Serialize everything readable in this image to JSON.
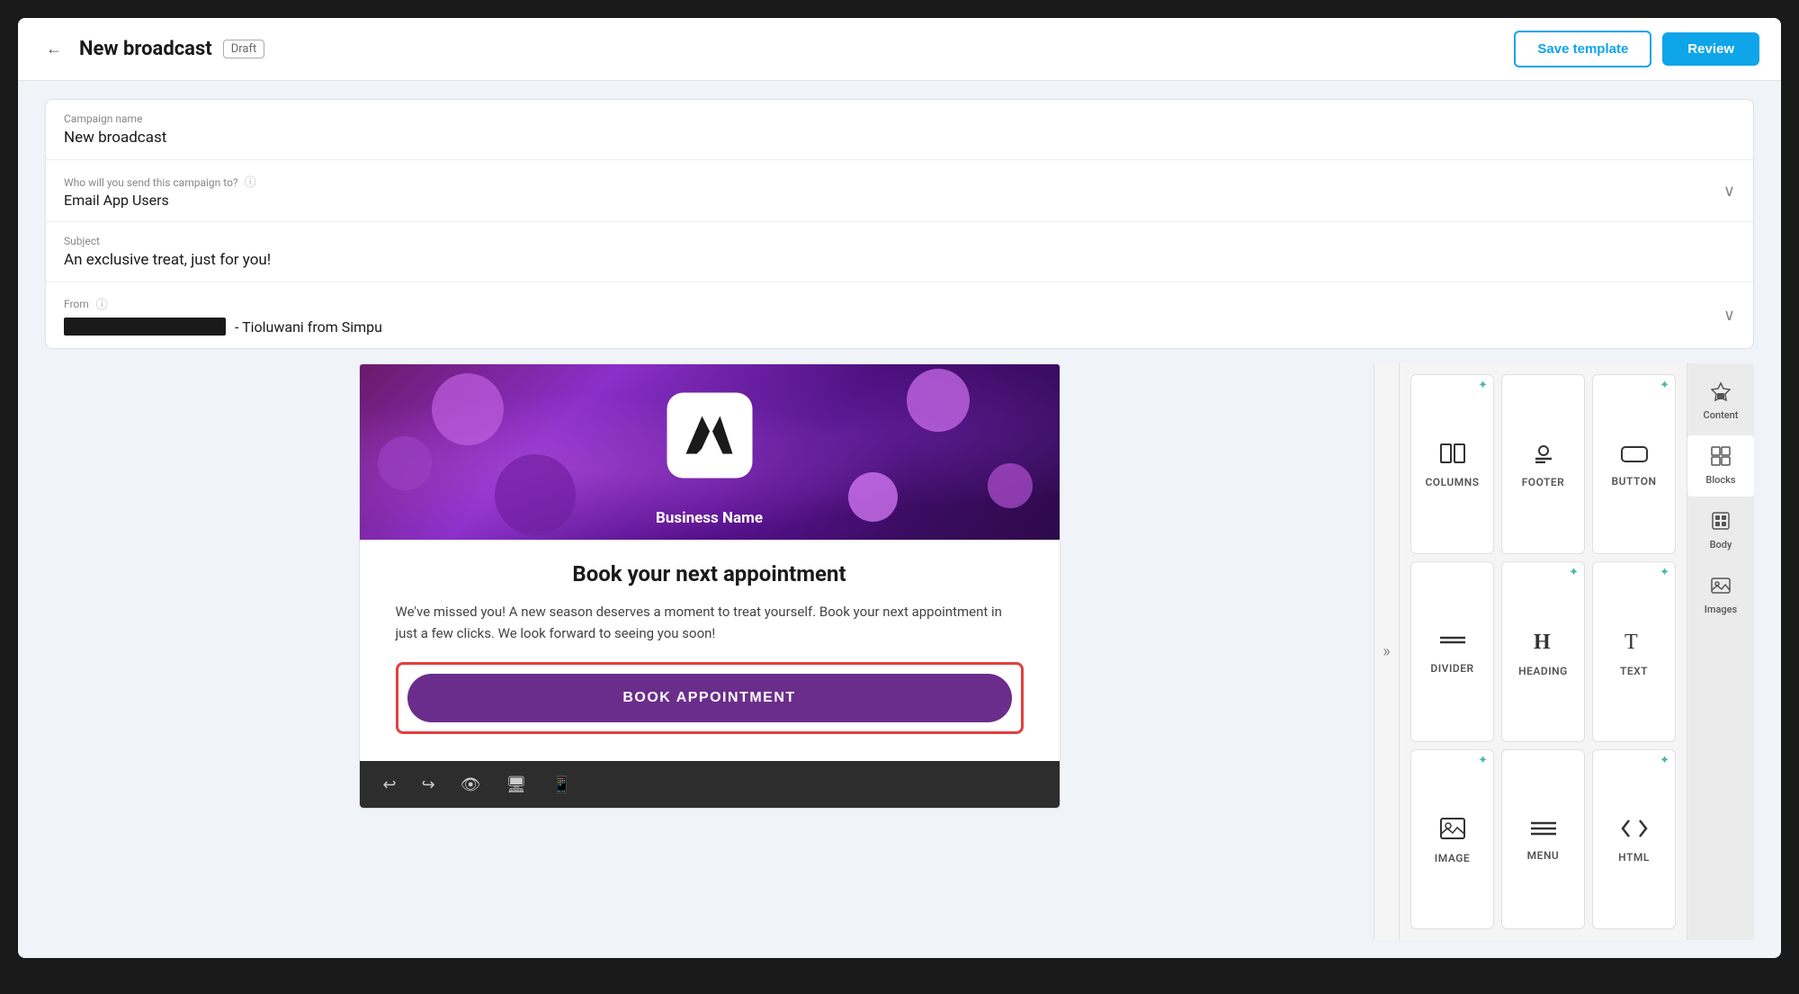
{
  "header": {
    "back_label": "←",
    "title": "New broadcast",
    "badge": "Draft",
    "save_template_label": "Save template",
    "review_label": "Review"
  },
  "form": {
    "campaign_name_label": "Campaign name",
    "campaign_name_value": "New broadcast",
    "recipients_label": "Who will you send this campaign to?",
    "recipients_value": "Email App Users",
    "subject_label": "Subject",
    "subject_value": "An exclusive treat, just for you!",
    "from_label": "From",
    "from_suffix": "- Tioluwani from Simpu"
  },
  "email_preview": {
    "business_name": "Business Name",
    "heading": "Book your next appointment",
    "body_text": "We've missed you! A new season deserves a moment to treat yourself. Book your next appointment in just a few clicks. We look forward to seeing you soon!",
    "cta_label": "BOOK APPOINTMENT"
  },
  "toolbar": {
    "undo_title": "Undo",
    "redo_title": "Redo",
    "preview_title": "Preview",
    "desktop_title": "Desktop",
    "mobile_title": "Mobile"
  },
  "blocks_panel": {
    "items": [
      {
        "id": "columns",
        "label": "COLUMNS",
        "icon": "columns"
      },
      {
        "id": "footer",
        "label": "FOOTER",
        "icon": "footer"
      },
      {
        "id": "button",
        "label": "BUTTON",
        "icon": "button"
      },
      {
        "id": "divider",
        "label": "DIVIDER",
        "icon": "divider"
      },
      {
        "id": "heading",
        "label": "HEADING",
        "icon": "heading"
      },
      {
        "id": "text",
        "label": "TEXT",
        "icon": "text"
      },
      {
        "id": "image",
        "label": "IMAGE",
        "icon": "image"
      },
      {
        "id": "menu",
        "label": "MENU",
        "icon": "menu"
      },
      {
        "id": "html",
        "label": "HTML",
        "icon": "html"
      }
    ]
  },
  "right_panel": {
    "items": [
      {
        "id": "content",
        "label": "Content",
        "icon": "▲▦"
      },
      {
        "id": "blocks",
        "label": "Blocks",
        "icon": "⊞",
        "active": true
      },
      {
        "id": "body",
        "label": "Body",
        "icon": "▦"
      },
      {
        "id": "images",
        "label": "Images",
        "icon": "🖼"
      }
    ]
  }
}
